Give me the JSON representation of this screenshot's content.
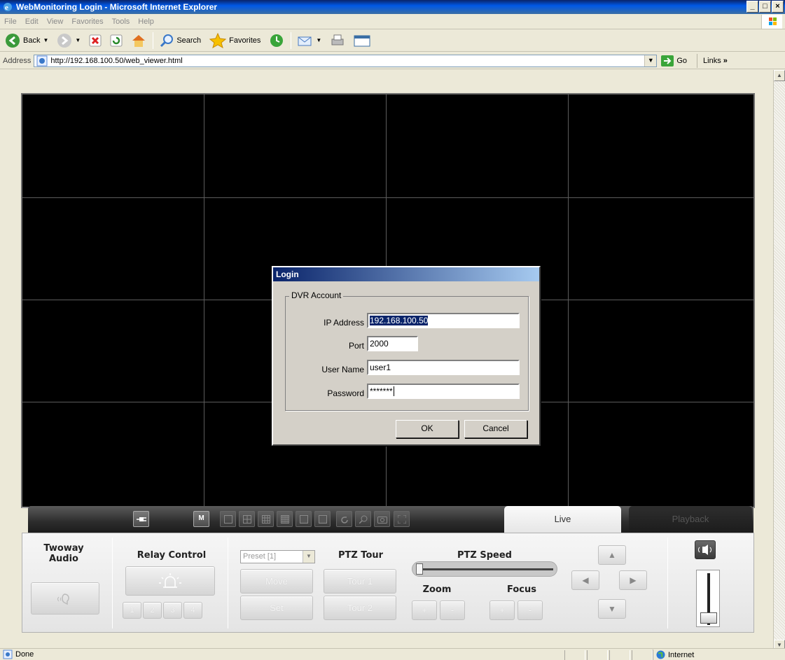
{
  "window": {
    "title": "WebMonitoring Login - Microsoft Internet Explorer",
    "minimize": "_",
    "maximize": "□",
    "close": "×"
  },
  "menu": [
    "File",
    "Edit",
    "View",
    "Favorites",
    "Tools",
    "Help"
  ],
  "toolbar": {
    "back_label": "Back",
    "search_label": "Search",
    "favorites_label": "Favorites"
  },
  "address": {
    "label": "Address",
    "url": "http://192.168.100.50/web_viewer.html",
    "go_label": "Go",
    "links_label": "Links"
  },
  "viewer": {
    "tabs": {
      "live": "Live",
      "playback": "Playback"
    },
    "m_button": "M",
    "panel": {
      "twoway_audio": "Twoway\nAudio",
      "relay_control": "Relay Control",
      "relay_numbers": [
        "1",
        "2",
        "3",
        "4"
      ],
      "preset_select": "Preset [1]",
      "move": "Move",
      "set": "Set",
      "ptz_tour": "PTZ Tour",
      "tour1": "Tour 1",
      "tour2": "Tour 2",
      "ptz_speed": "PTZ Speed",
      "zoom": "Zoom",
      "focus": "Focus",
      "plus": "+",
      "minus": "-"
    }
  },
  "dialog": {
    "title": "Login",
    "group_label": "DVR Account",
    "ip_label": "IP Address",
    "ip_value": "192.168.100.50",
    "port_label": "Port",
    "port_value": "2000",
    "user_label": "User Name",
    "user_value": "user1",
    "password_label": "Password",
    "password_value": "*******",
    "ok": "OK",
    "cancel": "Cancel"
  },
  "status": {
    "text": "Done",
    "zone": "Internet"
  }
}
